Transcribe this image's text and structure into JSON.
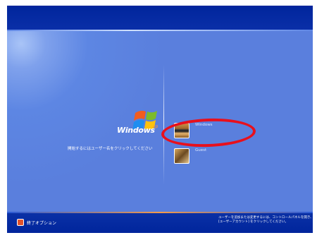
{
  "screen": {
    "brand": {
      "windows": "Windows",
      "edition": "xp"
    },
    "instruction": "開始するにはユーザー名をクリックしてください",
    "users": [
      {
        "name": "Windows",
        "picture": "chess-picture-icon"
      },
      {
        "name": "Guest",
        "picture": "duck-picture-icon"
      }
    ],
    "shutdown": {
      "label": "終了オプション",
      "icon": "power-icon"
    },
    "bottom_note": [
      "ユーザーを追加または変更するには、コントロールパネルを開き、",
      "[ユーザーアカウント] をクリックしてください。"
    ],
    "colors": {
      "top_band": "#00259c",
      "main": "#5a7fdd",
      "highlight": "#e8101c",
      "bottom_band": "#00259c"
    }
  }
}
